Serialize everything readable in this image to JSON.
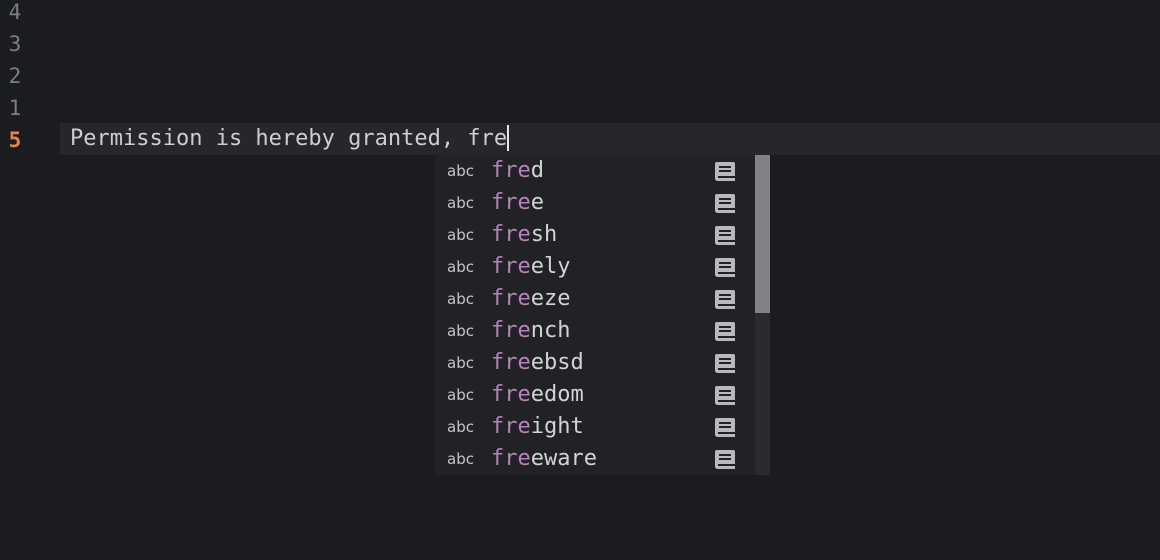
{
  "gutter": {
    "lines": [
      "4",
      "3",
      "2",
      "1",
      "5"
    ]
  },
  "editor": {
    "current_line_text": "Permission is hereby granted, fre"
  },
  "completion": {
    "typed_prefix": "fre",
    "items": [
      {
        "kind": "abc",
        "match": "fre",
        "rest": "d",
        "icon": "book-icon"
      },
      {
        "kind": "abc",
        "match": "fre",
        "rest": "e",
        "icon": "book-icon"
      },
      {
        "kind": "abc",
        "match": "fre",
        "rest": "sh",
        "icon": "book-icon"
      },
      {
        "kind": "abc",
        "match": "fre",
        "rest": "ely",
        "icon": "book-icon"
      },
      {
        "kind": "abc",
        "match": "fre",
        "rest": "eze",
        "icon": "book-icon"
      },
      {
        "kind": "abc",
        "match": "fre",
        "rest": "nch",
        "icon": "book-icon"
      },
      {
        "kind": "abc",
        "match": "fre",
        "rest": "ebsd",
        "icon": "book-icon"
      },
      {
        "kind": "abc",
        "match": "fre",
        "rest": "edom",
        "icon": "book-icon"
      },
      {
        "kind": "abc",
        "match": "fre",
        "rest": "ight",
        "icon": "book-icon"
      },
      {
        "kind": "abc",
        "match": "fre",
        "rest": "eware",
        "icon": "book-icon"
      }
    ]
  },
  "colors": {
    "background": "#1b1c1f",
    "current_line_number": "#e8834f",
    "match_highlight": "#b383ba",
    "popup_background": "#212225"
  }
}
